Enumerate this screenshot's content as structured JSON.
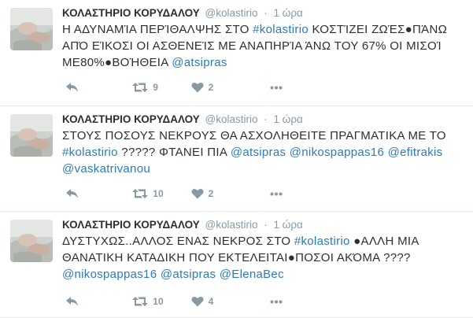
{
  "tweets": [
    {
      "fullname": "ΚΟΛΑΣΤΗΡΙΟ ΚΟΡΥΔΑΛΟΥ",
      "username": "@kolastirio",
      "separator": "·",
      "time": "1 ώρα",
      "text": [
        {
          "t": "Η ΑΔΥΝΑΜΊΑ ΠΕΡΊΘΑΛΨΗΣ ΣΤΟ ",
          "link": false
        },
        {
          "t": "#kolastirio",
          "link": true
        },
        {
          "t": " ΚΟΣΤΊΖΕΙ ΖΩΈΣ●ΠΆΝΩ ΑΠΌ ΕΊΚΟΣΙ ΟΙ ΑΣΘΕΝΕΊΣ ΜΕ ΑΝΑΠΗΡΊΑ ΆΝΩ ΤΟΥ 67% ΟΙ ΜΙΣΟΊ ΜΕ80%●ΒΟΉΘΕΙΑ ",
          "link": false
        },
        {
          "t": "@atsipras",
          "link": true
        }
      ],
      "retweets": "9",
      "likes": "2"
    },
    {
      "fullname": "ΚΟΛΑΣΤΗΡΙΟ ΚΟΡΥΔΑΛΟΥ",
      "username": "@kolastirio",
      "separator": "·",
      "time": "1 ώρα",
      "text": [
        {
          "t": "ΣΤΟΥΣ ΠΟΣΟΥΣ ΝΕΚΡΟΥΣ ΘΑ ΑΣΧΟΛΗΘΕΙΤΕ ΠΡΑΓΜΑΤΙΚΑ ΜΕ ΤΟ ",
          "link": false
        },
        {
          "t": "#kolastirio",
          "link": true
        },
        {
          "t": " ????? ΦΤΑΝΕΙ ΠΙΑ ",
          "link": false
        },
        {
          "t": "@atsipras",
          "link": true
        },
        {
          "t": " ",
          "link": false
        },
        {
          "t": "@nikospappas16",
          "link": true
        },
        {
          "t": " ",
          "link": false
        },
        {
          "t": "@efitrakis",
          "link": true
        },
        {
          "t": " ",
          "link": false
        },
        {
          "t": "@vaskatrivanou",
          "link": true
        }
      ],
      "retweets": "10",
      "likes": "2"
    },
    {
      "fullname": "ΚΟΛΑΣΤΗΡΙΟ ΚΟΡΥΔΑΛΟΥ",
      "username": "@kolastirio",
      "separator": "·",
      "time": "1 ώρα",
      "text": [
        {
          "t": "ΔΥΣΤΥΧΩΣ..ΑΛΛΟΣ ΕΝΑΣ ΝΕΚΡΟΣ ΣΤΟ ",
          "link": false
        },
        {
          "t": "#kolastirio",
          "link": true
        },
        {
          "t": "  ●ΑΛΛΗ ΜΙΑ ΘΑΝΑΤΙΚΗ ΚΑΤΑΔΙΚΗ ΠΟΥ ΕΚΤΕΛΕΙΤΑΙ●ΠΟΣΟΙ ΑΚΌΜΑ ???? ",
          "link": false
        },
        {
          "t": "@nikospappas16",
          "link": true
        },
        {
          "t": " ",
          "link": false
        },
        {
          "t": "@atsipras",
          "link": true
        },
        {
          "t": " ",
          "link": false
        },
        {
          "t": "@ElenaBec",
          "link": true
        }
      ],
      "retweets": "10",
      "likes": "4"
    }
  ],
  "icons": {
    "reply": "reply-icon",
    "retweet": "retweet-icon",
    "like": "like-icon",
    "more": "more-icon"
  },
  "colors": {
    "link": "#2b7bb9",
    "text": "#292f33",
    "muted": "#8899a6",
    "divider": "#e1e8ed"
  }
}
